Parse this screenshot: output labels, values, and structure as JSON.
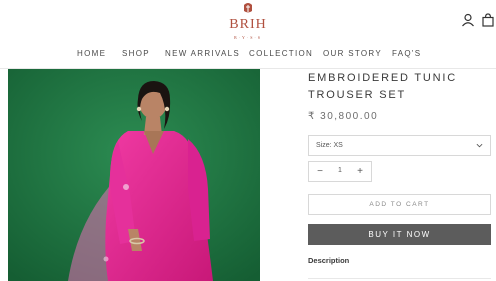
{
  "brand": {
    "name": "BRIH",
    "tagline": "B·Y·S·S",
    "accent_color": "#b0503f"
  },
  "header_icons": {
    "account": "account-icon",
    "bag": "shopping-bag-icon"
  },
  "nav": {
    "items": [
      {
        "label": "HOME"
      },
      {
        "label": "SHOP"
      },
      {
        "label": "NEW ARRIVALS"
      },
      {
        "label": "COLLECTION"
      },
      {
        "label": "OUR STORY"
      },
      {
        "label": "FAQ'S"
      }
    ]
  },
  "product": {
    "title_line1": "EMBROIDERED TUNIC",
    "title_line2": "TROUSER SET",
    "price": "₹ 30,800.00",
    "size_select": "Size: XS",
    "quantity": "1",
    "minus_label": "−",
    "plus_label": "+",
    "add_to_cart": "ADD TO CART",
    "buy_now": "BUY IT NOW",
    "description_heading": "Description",
    "buy_color": "#5c5c5c"
  },
  "photo": {
    "background_color": "#1f7a43",
    "garment_color": "#e0208f"
  }
}
